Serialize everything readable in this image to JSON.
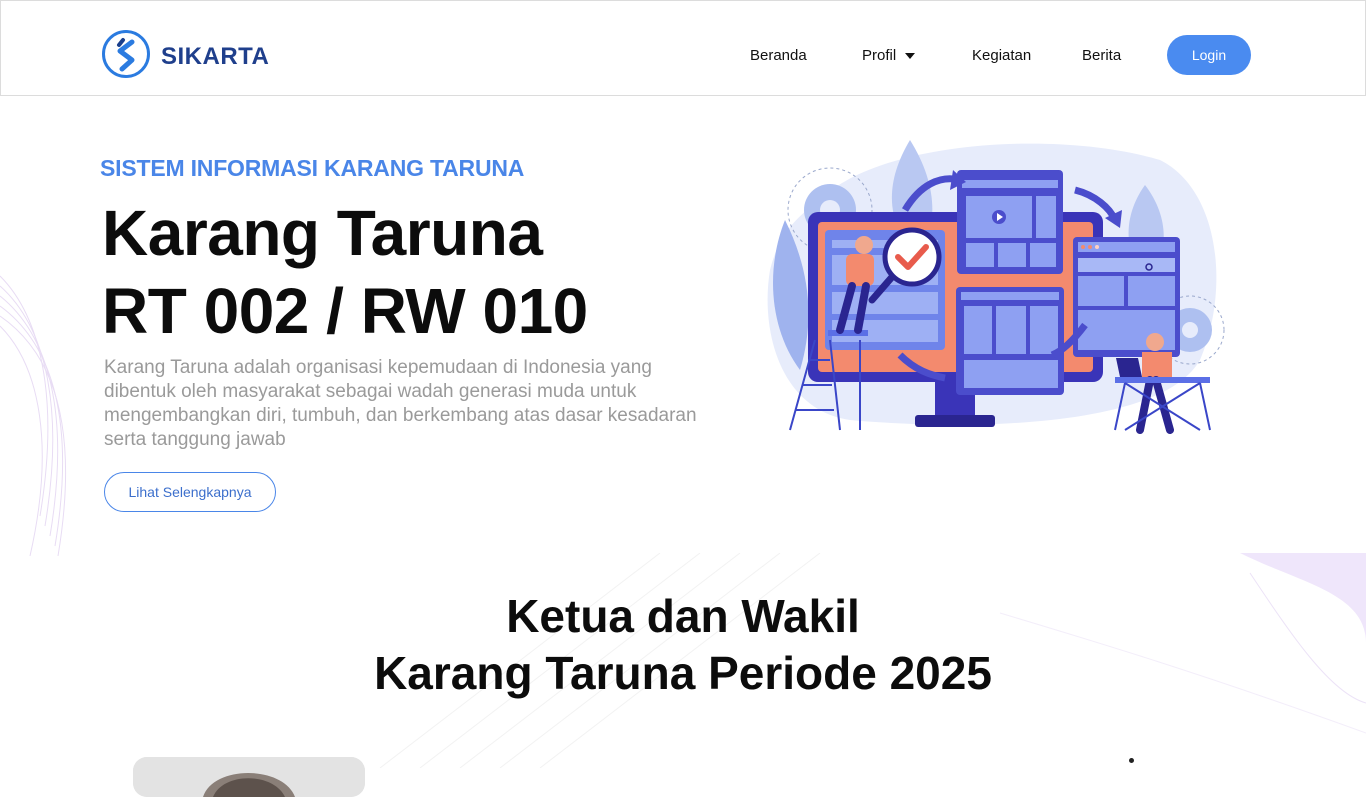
{
  "brand": {
    "name": "SIKARTA",
    "logo_icon": "s-logo-icon",
    "color": "#1f3f8c"
  },
  "nav": {
    "items": [
      {
        "label": "Beranda"
      },
      {
        "label": "Profil",
        "has_dropdown": true
      },
      {
        "label": "Kegiatan"
      },
      {
        "label": "Berita"
      }
    ],
    "login_label": "Login"
  },
  "hero": {
    "eyebrow": "SISTEM INFORMASI KARANG TARUNA",
    "title_line1": "Karang Taruna",
    "title_line2": "RT 002 / RW 010",
    "description": "Karang Taruna adalah organisasi kepemudaan di Indonesia yang dibentuk oleh masyarakat sebagai wadah generasi muda untuk mengembangkan diri, tumbuh, dan berkembang atas dasar kesadaran serta tanggung jawab",
    "button_label": "Lihat Selengkapnya",
    "illustration_icon": "web-development-illustration"
  },
  "section": {
    "title_line1": "Ketua dan Wakil",
    "title_line2": "Karang Taruna Periode 2025"
  },
  "colors": {
    "accent": "#4a86e8",
    "login_button": "#4a8bf0",
    "text_dark": "#0c0c0c",
    "text_muted": "#9a9a9a"
  }
}
